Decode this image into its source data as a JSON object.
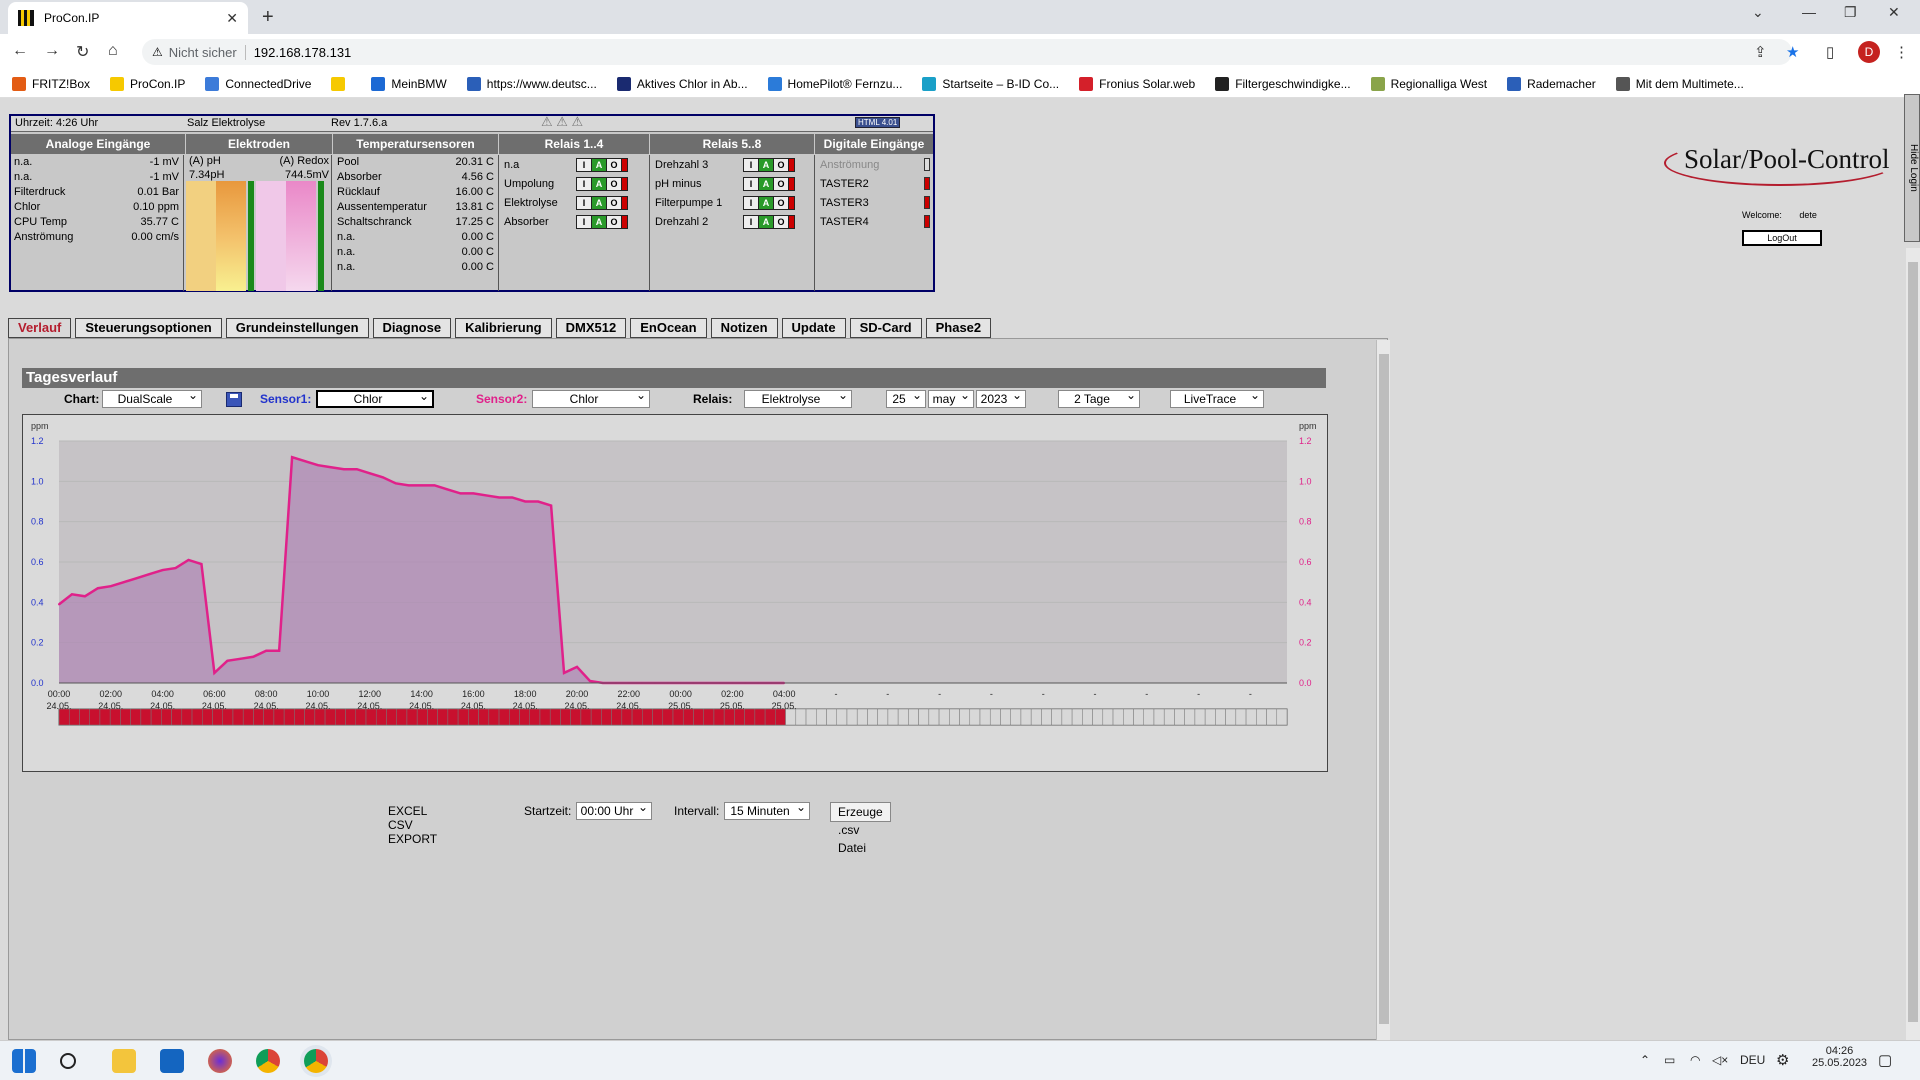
{
  "browser": {
    "tab_title": "ProCon.IP",
    "url_security": "Nicht sicher",
    "url": "192.168.178.131",
    "avatar": "D",
    "bookmarks": [
      "FRITZ!Box",
      "ProCon.IP",
      "ConnectedDrive",
      "",
      "MeinBMW",
      "https://www.deutsc...",
      "Aktives Chlor in Ab...",
      "HomePilot® Fernzu...",
      "Startseite – B-ID Co...",
      "Fronius Solar.web",
      "Filtergeschwindigke...",
      "Regionalliga West",
      "Rademacher",
      "Mit dem Multimete..."
    ]
  },
  "status_bar": {
    "time": "Uhrzeit: 4:26 Uhr",
    "mode": "Salz Elektrolyse",
    "rev": "Rev 1.7.6.a",
    "html_badge": "HTML 4.01"
  },
  "headers": [
    "Analoge Eingänge",
    "Elektroden",
    "Temperatursensoren",
    "Relais 1..4",
    "Relais 5..8",
    "Digitale Eingänge"
  ],
  "analog": [
    {
      "label": "n.a.",
      "value": "-1 mV"
    },
    {
      "label": "n.a.",
      "value": "-1 mV"
    },
    {
      "label": "Filterdruck",
      "value": "0.01 Bar"
    },
    {
      "label": "Chlor",
      "value": "0.10 ppm"
    },
    {
      "label": "CPU Temp",
      "value": "35.77 C"
    },
    {
      "label": "Anströmung",
      "value": "0.00 cm/s"
    }
  ],
  "electrodes": {
    "ph_label": "(A) pH",
    "ph_value": "7.34pH",
    "redox_label": "(A) Redox",
    "redox_value": "744.5mV"
  },
  "temps": [
    {
      "label": "Pool",
      "value": "20.31 C"
    },
    {
      "label": "Absorber",
      "value": "4.56 C"
    },
    {
      "label": "Rücklauf",
      "value": "16.00 C"
    },
    {
      "label": "Aussentemperatur",
      "value": "13.81 C"
    },
    {
      "label": "Schaltschranck",
      "value": "17.25 C"
    },
    {
      "label": "n.a.",
      "value": "0.00 C"
    },
    {
      "label": "n.a.",
      "value": "0.00 C"
    },
    {
      "label": "n.a.",
      "value": "0.00 C"
    }
  ],
  "relais1": [
    "n.a",
    "Umpolung",
    "Elektrolyse",
    "Absorber"
  ],
  "relais2": [
    "Drehzahl 3",
    "pH minus",
    "Filterpumpe 1",
    "Drehzahl 2"
  ],
  "digital": [
    "Anströmung",
    "TASTER2",
    "TASTER3",
    "TASTER4"
  ],
  "login": {
    "welcome_label": "Welcome:",
    "user": "dete",
    "logout": "LogOut",
    "hide": "Hide Login"
  },
  "logo_text": "Solar/Pool-Control",
  "tabs": [
    "Verlauf",
    "Steuerungsoptionen",
    "Grundeinstellungen",
    "Diagnose",
    "Kalibrierung",
    "DMX512",
    "EnOcean",
    "Notizen",
    "Update",
    "SD-Card",
    "Phase2"
  ],
  "section_title": "Tagesverlauf",
  "controls": {
    "chart_label": "Chart:",
    "chart_value": "DualScale",
    "sensor1_label": "Sensor1:",
    "sensor1_value": "Chlor",
    "sensor2_label": "Sensor2:",
    "sensor2_value": "Chlor",
    "relais_label": "Relais:",
    "relais_value": "Elektrolyse",
    "day": "25",
    "month": "may",
    "year": "2023",
    "range": "2 Tage",
    "mode": "LiveTrace"
  },
  "chart_data": {
    "type": "area",
    "unit_left": "ppm",
    "unit_right": "ppm",
    "ylim": [
      0,
      1.2
    ],
    "yticks": [
      "0.0",
      "0.2",
      "0.4",
      "0.6",
      "0.8",
      "1.0",
      "1.2"
    ],
    "xticks": [
      {
        "t": "00:00",
        "d": "24.05."
      },
      {
        "t": "02:00",
        "d": "24.05."
      },
      {
        "t": "04:00",
        "d": "24.05."
      },
      {
        "t": "06:00",
        "d": "24.05."
      },
      {
        "t": "08:00",
        "d": "24.05."
      },
      {
        "t": "10:00",
        "d": "24.05."
      },
      {
        "t": "12:00",
        "d": "24.05."
      },
      {
        "t": "14:00",
        "d": "24.05."
      },
      {
        "t": "16:00",
        "d": "24.05."
      },
      {
        "t": "18:00",
        "d": "24.05."
      },
      {
        "t": "20:00",
        "d": "24.05."
      },
      {
        "t": "22:00",
        "d": "24.05."
      },
      {
        "t": "00:00",
        "d": "25.05."
      },
      {
        "t": "02:00",
        "d": "25.05."
      },
      {
        "t": "04:00",
        "d": "25.05."
      },
      {
        "t": "-",
        "d": ""
      },
      {
        "t": "-",
        "d": ""
      },
      {
        "t": "-",
        "d": ""
      },
      {
        "t": "-",
        "d": ""
      },
      {
        "t": "-",
        "d": ""
      },
      {
        "t": "-",
        "d": ""
      },
      {
        "t": "-",
        "d": ""
      },
      {
        "t": "-",
        "d": ""
      },
      {
        "t": "-",
        "d": ""
      }
    ],
    "series": [
      {
        "color": "#e0218a",
        "x": [
          "24.05. 00:00",
          "24.05. 00:30",
          "24.05. 01:00",
          "24.05. 01:30",
          "24.05. 02:00",
          "24.05. 02:30",
          "24.05. 03:00",
          "24.05. 03:30",
          "24.05. 04:00",
          "24.05. 04:30",
          "24.05. 05:00",
          "24.05. 05:30",
          "24.05. 06:00",
          "24.05. 06:30",
          "24.05. 07:00",
          "24.05. 07:30",
          "24.05. 08:00",
          "24.05. 08:30",
          "24.05. 09:00",
          "24.05. 09:30",
          "24.05. 10:00",
          "24.05. 10:30",
          "24.05. 11:00",
          "24.05. 11:30",
          "24.05. 12:00",
          "24.05. 12:30",
          "24.05. 13:00",
          "24.05. 13:30",
          "24.05. 14:00",
          "24.05. 14:30",
          "24.05. 15:00",
          "24.05. 15:30",
          "24.05. 16:00",
          "24.05. 16:30",
          "24.05. 17:00",
          "24.05. 17:30",
          "24.05. 18:00",
          "24.05. 18:30",
          "24.05. 19:00",
          "24.05. 19:30",
          "24.05. 20:00",
          "24.05. 20:30",
          "24.05. 21:00",
          "24.05. 21:30",
          "24.05. 22:00",
          "24.05. 22:30",
          "24.05. 23:00",
          "24.05. 23:30",
          "25.05. 00:00",
          "25.05. 00:30",
          "25.05. 01:00",
          "25.05. 01:30",
          "25.05. 02:00",
          "25.05. 02:30",
          "25.05. 03:00",
          "25.05. 03:30",
          "25.05. 04:00"
        ],
        "values": [
          0.39,
          0.44,
          0.43,
          0.47,
          0.48,
          0.5,
          0.52,
          0.54,
          0.56,
          0.57,
          0.61,
          0.59,
          0.05,
          0.11,
          0.12,
          0.13,
          0.16,
          0.16,
          1.12,
          1.1,
          1.08,
          1.07,
          1.06,
          1.06,
          1.04,
          1.02,
          0.99,
          0.98,
          0.98,
          0.98,
          0.96,
          0.94,
          0.94,
          0.93,
          0.92,
          0.92,
          0.9,
          0.9,
          0.88,
          0.05,
          0.08,
          0.01,
          0,
          0,
          0,
          0,
          0,
          0,
          0,
          0,
          0,
          0,
          0,
          0,
          0,
          0,
          0
        ]
      }
    ],
    "relay_on_fraction": 0.59,
    "grid": true
  },
  "export": {
    "label": "EXCEL CSV EXPORT",
    "start_label": "Startzeit:",
    "start_value": "00:00 Uhr",
    "interval_label": "Intervall:",
    "interval_value": "15 Minuten",
    "button": "Erzeuge .csv Datei"
  },
  "taskbar": {
    "lang": "DEU",
    "time": "04:26",
    "date": "25.05.2023"
  }
}
